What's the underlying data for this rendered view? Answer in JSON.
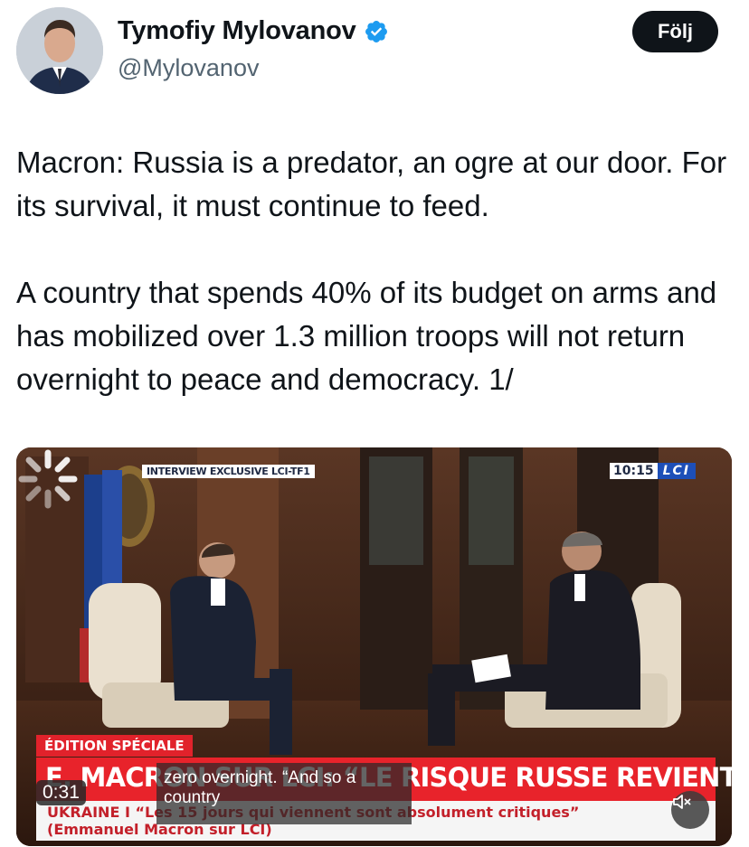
{
  "user": {
    "display_name": "Tymofiy Mylovanov",
    "handle": "@Mylovanov",
    "verified_icon": "verified-badge-icon",
    "verified_color": "#1d9bf0"
  },
  "follow_button": {
    "label": "Följ"
  },
  "tweet": {
    "text": "Macron: Russia is a predator, an ogre at our door. For its survival, it must continue to feed.\n\nA country that spends 40% of its budget on arms and has mobilized over 1.3 million troops will not return overnight to peace and democracy. 1/"
  },
  "video": {
    "interview_label": "INTERVIEW EXCLUSIVE LCI-TF1",
    "clock": "10:15",
    "channel": "LCI",
    "edition_label": "ÉDITION SPÉCIALE",
    "headline": "E. MACRON SUR LCI: “LE RISQUE RUSSE REVIENT”",
    "subline_1": "UKRAINE I “Les 15 jours qui viennent sont absolument critiques”",
    "subline_2": "(Emmanuel Macron sur LCI)",
    "caption": "zero overnight. “And so a country",
    "elapsed": "0:31",
    "mute_icon": "muted-speaker-icon",
    "loading_icon": "loading-spinner-icon"
  }
}
